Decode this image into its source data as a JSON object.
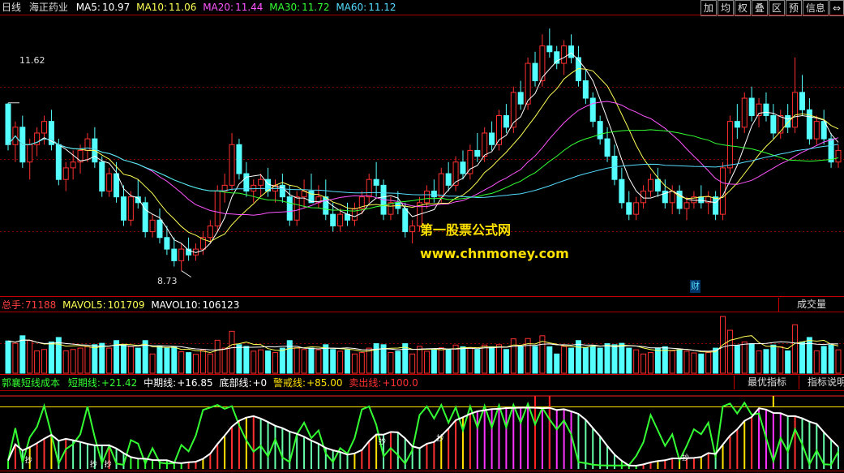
{
  "colors": {
    "up": "#ff3030",
    "down": "#54ffff",
    "ma5": "#ffffff",
    "ma10": "#ffff55",
    "ma20": "#ff55ff",
    "ma30": "#33ff33",
    "ma60": "#55ddff",
    "grid": "#aa0000",
    "yellow": "#ffe100",
    "green": "#33ff33",
    "red": "#ff2020",
    "orange": "#ff8800",
    "mag": "#ff33ff",
    "pink": "#ff8888"
  },
  "header": {
    "period": "日线",
    "stock": "海正药业",
    "ma5_label": "MA5:",
    "ma5": "10.97",
    "ma10_label": "MA10:",
    "ma10": "11.06",
    "ma20_label": "MA20:",
    "ma20": "11.44",
    "ma30_label": "MA30:",
    "ma30": "11.72",
    "ma60_label": "MA60:",
    "ma60": "11.12"
  },
  "toolbar": [
    "加",
    "均",
    "权",
    "叠",
    "区",
    "预",
    "信息",
    "⇔"
  ],
  "price_labels": {
    "high": "11.62",
    "low": "8.73",
    "event": "财"
  },
  "watermark": {
    "line1": "第一股票公式网",
    "line2": "www.chnmoney.com"
  },
  "volume": {
    "total_label": "总手:",
    "total": "71188",
    "mavol5_label": "MAVOL5:",
    "mavol5": "101709",
    "mavol10_label": "MAVOL10:",
    "mavol10": "106123",
    "button": "成交量"
  },
  "indicator": {
    "name": "郭襄短线成本",
    "short_label": "短期线:",
    "short": "+21.42",
    "mid_label": "中期线:",
    "mid": "+16.85",
    "bottom_label": "底部线:",
    "bottom": "+0",
    "warn_label": "警戒线:",
    "warn": "+85.00",
    "sell_label": "卖出线:",
    "sell": "+100.0",
    "best_button": "最优指标",
    "help_button": "指标说明",
    "marker": "抄"
  },
  "chart_data": {
    "type": "candlestick",
    "ohlc": [
      [
        11.6,
        11.62,
        10.8,
        10.9
      ],
      [
        10.9,
        11.3,
        10.6,
        11.2
      ],
      [
        11.2,
        11.4,
        10.5,
        10.6
      ],
      [
        10.6,
        11.0,
        10.3,
        10.9
      ],
      [
        10.9,
        11.2,
        10.7,
        11.1
      ],
      [
        11.1,
        11.4,
        10.9,
        11.3
      ],
      [
        11.3,
        11.5,
        10.8,
        10.9
      ],
      [
        10.9,
        11.0,
        10.2,
        10.3
      ],
      [
        10.3,
        10.6,
        10.1,
        10.5
      ],
      [
        10.5,
        10.8,
        10.3,
        10.6
      ],
      [
        10.6,
        10.9,
        10.4,
        10.8
      ],
      [
        10.8,
        11.1,
        10.6,
        11.0
      ],
      [
        11.0,
        11.2,
        10.5,
        10.6
      ],
      [
        10.6,
        10.7,
        10.0,
        10.1
      ],
      [
        10.1,
        10.5,
        10.0,
        10.4
      ],
      [
        10.4,
        10.6,
        9.9,
        10.0
      ],
      [
        10.0,
        10.2,
        9.5,
        9.6
      ],
      [
        9.6,
        10.1,
        9.5,
        10.0
      ],
      [
        10.0,
        10.3,
        9.8,
        9.9
      ],
      [
        9.9,
        10.0,
        9.3,
        9.4
      ],
      [
        9.4,
        9.7,
        9.3,
        9.6
      ],
      [
        9.6,
        9.8,
        9.2,
        9.3
      ],
      [
        9.3,
        9.5,
        9.0,
        9.1
      ],
      [
        9.1,
        9.3,
        8.8,
        8.9
      ],
      [
        8.9,
        9.2,
        8.73,
        9.1
      ],
      [
        9.1,
        9.3,
        8.9,
        9.0
      ],
      [
        9.0,
        9.2,
        8.9,
        9.1
      ],
      [
        9.1,
        9.4,
        9.0,
        9.3
      ],
      [
        9.3,
        9.6,
        9.2,
        9.5
      ],
      [
        9.5,
        10.2,
        9.4,
        10.1
      ],
      [
        10.1,
        10.4,
        9.9,
        10.2
      ],
      [
        10.2,
        11.1,
        10.1,
        10.9
      ],
      [
        10.9,
        11.0,
        10.3,
        10.4
      ],
      [
        10.4,
        10.6,
        10.0,
        10.1
      ],
      [
        10.1,
        10.3,
        9.9,
        10.2
      ],
      [
        10.2,
        10.4,
        10.0,
        10.3
      ],
      [
        10.3,
        10.5,
        10.0,
        10.1
      ],
      [
        10.1,
        10.3,
        9.9,
        10.2
      ],
      [
        10.2,
        10.4,
        9.9,
        10.0
      ],
      [
        10.0,
        10.2,
        9.5,
        9.6
      ],
      [
        9.6,
        10.1,
        9.5,
        10.0
      ],
      [
        10.0,
        10.3,
        9.8,
        10.1
      ],
      [
        10.1,
        10.4,
        9.9,
        9.9
      ],
      [
        9.9,
        10.2,
        9.8,
        10.0
      ],
      [
        10.0,
        10.3,
        9.6,
        9.7
      ],
      [
        9.7,
        9.9,
        9.4,
        9.5
      ],
      [
        9.5,
        9.8,
        9.4,
        9.7
      ],
      [
        9.7,
        9.9,
        9.5,
        9.6
      ],
      [
        9.6,
        9.9,
        9.5,
        9.8
      ],
      [
        9.8,
        10.1,
        9.7,
        10.0
      ],
      [
        10.0,
        10.4,
        9.9,
        10.3
      ],
      [
        10.3,
        10.6,
        10.0,
        10.2
      ],
      [
        10.2,
        10.3,
        9.6,
        9.7
      ],
      [
        9.7,
        10.0,
        9.6,
        9.9
      ],
      [
        9.9,
        10.1,
        9.7,
        9.8
      ],
      [
        9.8,
        9.9,
        9.3,
        9.4
      ],
      [
        9.4,
        9.6,
        9.2,
        9.5
      ],
      [
        9.5,
        10.0,
        9.4,
        9.9
      ],
      [
        9.9,
        10.2,
        9.8,
        10.1
      ],
      [
        10.1,
        10.3,
        9.9,
        10.0
      ],
      [
        10.0,
        10.5,
        9.9,
        10.4
      ],
      [
        10.4,
        10.6,
        10.1,
        10.2
      ],
      [
        10.2,
        10.7,
        10.1,
        10.6
      ],
      [
        10.6,
        10.8,
        10.3,
        10.4
      ],
      [
        10.4,
        10.9,
        10.3,
        10.8
      ],
      [
        10.8,
        11.1,
        10.6,
        10.7
      ],
      [
        10.7,
        11.2,
        10.6,
        11.1
      ],
      [
        11.1,
        11.3,
        10.8,
        10.9
      ],
      [
        10.9,
        11.5,
        10.8,
        11.4
      ],
      [
        11.4,
        11.6,
        11.1,
        11.2
      ],
      [
        11.2,
        11.9,
        11.1,
        11.8
      ],
      [
        11.8,
        12.0,
        11.5,
        11.6
      ],
      [
        11.6,
        12.4,
        11.5,
        12.3
      ],
      [
        12.3,
        12.5,
        11.9,
        12.0
      ],
      [
        12.0,
        12.8,
        11.9,
        12.6
      ],
      [
        12.6,
        12.9,
        12.4,
        12.5
      ],
      [
        12.5,
        12.6,
        12.2,
        12.3
      ],
      [
        12.3,
        12.7,
        12.1,
        12.6
      ],
      [
        12.6,
        12.8,
        12.3,
        12.4
      ],
      [
        12.4,
        12.6,
        11.9,
        12.0
      ],
      [
        12.0,
        12.2,
        11.6,
        11.7
      ],
      [
        11.7,
        11.8,
        11.2,
        11.3
      ],
      [
        11.3,
        11.4,
        10.9,
        11.0
      ],
      [
        11.0,
        11.2,
        10.6,
        10.7
      ],
      [
        10.7,
        10.9,
        10.2,
        10.3
      ],
      [
        10.3,
        10.5,
        9.8,
        9.9
      ],
      [
        9.9,
        10.1,
        9.6,
        9.7
      ],
      [
        9.7,
        10.0,
        9.6,
        9.9
      ],
      [
        9.9,
        10.2,
        9.8,
        10.1
      ],
      [
        10.1,
        10.4,
        10.0,
        10.3
      ],
      [
        10.3,
        10.5,
        10.0,
        10.1
      ],
      [
        10.1,
        10.3,
        9.8,
        9.9
      ],
      [
        9.9,
        10.2,
        9.7,
        10.1
      ],
      [
        10.1,
        10.2,
        9.7,
        9.8
      ],
      [
        9.8,
        10.0,
        9.6,
        9.9
      ],
      [
        9.9,
        10.1,
        9.8,
        10.0
      ],
      [
        10.0,
        10.2,
        9.8,
        9.9
      ],
      [
        9.9,
        10.1,
        9.7,
        10.0
      ],
      [
        10.0,
        10.1,
        9.6,
        9.7
      ],
      [
        9.7,
        10.6,
        9.6,
        10.5
      ],
      [
        10.5,
        11.4,
        10.4,
        11.3
      ],
      [
        11.3,
        11.6,
        11.0,
        11.2
      ],
      [
        11.2,
        11.8,
        11.1,
        11.7
      ],
      [
        11.7,
        11.9,
        11.3,
        11.4
      ],
      [
        11.4,
        11.7,
        11.2,
        11.6
      ],
      [
        11.6,
        11.8,
        11.3,
        11.4
      ],
      [
        11.4,
        11.6,
        11.0,
        11.1
      ],
      [
        11.1,
        11.5,
        11.0,
        11.4
      ],
      [
        11.4,
        11.6,
        11.1,
        11.2
      ],
      [
        11.2,
        12.4,
        11.1,
        11.8
      ],
      [
        11.8,
        12.1,
        11.4,
        11.5
      ],
      [
        11.5,
        11.7,
        10.9,
        11.0
      ],
      [
        11.0,
        11.4,
        10.9,
        11.3
      ],
      [
        11.3,
        11.5,
        10.9,
        11.0
      ],
      [
        11.0,
        11.1,
        10.5,
        10.6
      ],
      [
        10.6,
        10.9,
        10.5,
        10.8
      ]
    ]
  }
}
